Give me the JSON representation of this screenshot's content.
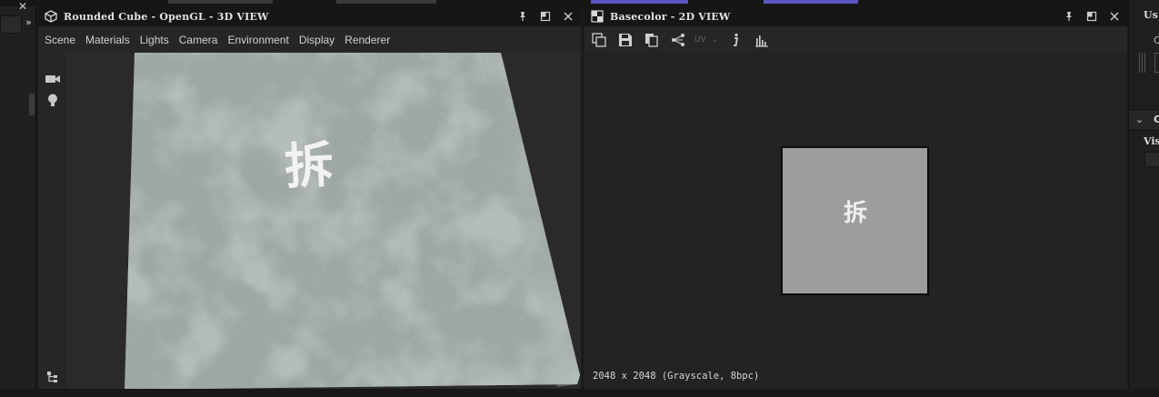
{
  "colors": {
    "accent": "#5b56c4",
    "texture_fill": "#9d9d9d",
    "cube_surface": "#9aa3a3"
  },
  "panel_3d": {
    "title": "Rounded Cube - OpenGL - 3D VIEW",
    "menu": [
      "Scene",
      "Materials",
      "Lights",
      "Camera",
      "Environment",
      "Display",
      "Renderer"
    ],
    "side_tools": [
      "camera-icon",
      "light-bulb-icon",
      "hierarchy-icon"
    ],
    "decal_text": "拆"
  },
  "panel_2d": {
    "title": "Basecolor - 2D VIEW",
    "toolbar": [
      "fit-view-icon",
      "save-icon",
      "copy-icon",
      "share-nodes-icon",
      "info-icon",
      "histogram-icon"
    ],
    "uv_label": "UV",
    "decal_text": "拆",
    "info": "2048 x 2048 (Grayscale, 8bpc)"
  },
  "right_panel": {
    "title": "Us",
    "label_c": "C",
    "section": "C",
    "vis_label": "Vis"
  }
}
